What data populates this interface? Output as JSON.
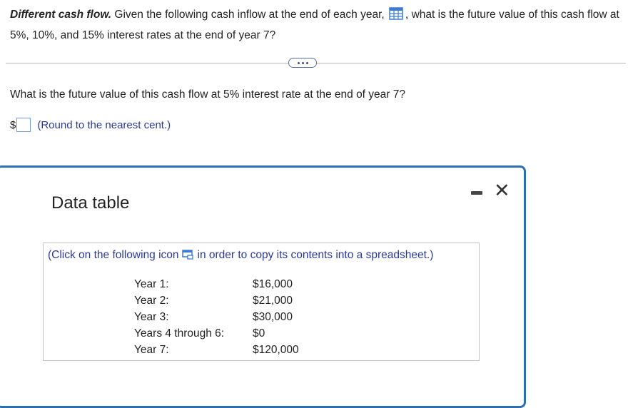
{
  "question": {
    "title": "Different cash flow.",
    "text_before_icon": " Given the following cash inflow at the end of each year, ",
    "text_after_icon": ", what is the future value of this cash flow at 5%, 10%, and 15% interest rates at the end of year 7?",
    "icon": "spreadsheet-grid-icon"
  },
  "sub_question": "What is the future value of this cash flow at 5% interest rate at the end of year 7?",
  "answer": {
    "currency": "$",
    "value": "",
    "hint": "(Round to the nearest cent.)"
  },
  "modal": {
    "title": "Data table",
    "minimize_label": "minimize",
    "close_label": "✕"
  },
  "data_table": {
    "copy_text_before": "(Click on the following icon",
    "copy_text_after": "in order to copy its contents into a spreadsheet.)",
    "rows": [
      {
        "label": "Year 1:",
        "value": "$16,000"
      },
      {
        "label": "Year 2:",
        "value": "$21,000"
      },
      {
        "label": "Year 3:",
        "value": "$30,000"
      },
      {
        "label": "Years 4 through 6:",
        "value": "$0"
      },
      {
        "label": "Year 7:",
        "value": "$120,000"
      }
    ]
  },
  "colors": {
    "accent_blue": "#2d6fb6",
    "link_text": "#2a3a9c",
    "icon_blue": "#3a7bd5"
  }
}
